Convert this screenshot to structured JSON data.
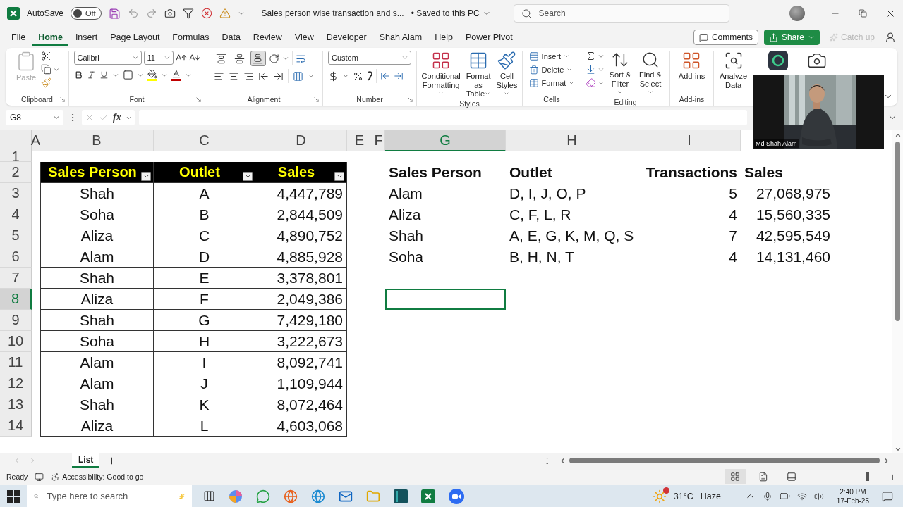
{
  "title_bar": {
    "autosave": {
      "label": "AutoSave",
      "state_label": "Off",
      "on": false
    },
    "document_title": "Sales person wise transaction and s...",
    "save_status": "• Saved to this PC",
    "search": {
      "placeholder": "Search"
    }
  },
  "menu_tabs": [
    {
      "label": "File",
      "selected": false
    },
    {
      "label": "Home",
      "selected": true
    },
    {
      "label": "Insert",
      "selected": false
    },
    {
      "label": "Page Layout",
      "selected": false
    },
    {
      "label": "Formulas",
      "selected": false
    },
    {
      "label": "Data",
      "selected": false
    },
    {
      "label": "Review",
      "selected": false
    },
    {
      "label": "View",
      "selected": false
    },
    {
      "label": "Developer",
      "selected": false
    },
    {
      "label": "Shah Alam",
      "selected": false
    },
    {
      "label": "Help",
      "selected": false
    },
    {
      "label": "Power Pivot",
      "selected": false
    }
  ],
  "header_actions": {
    "comments": "Comments",
    "share": "Share",
    "catch_up": {
      "label": "Catch up",
      "disabled": true
    }
  },
  "ribbon": {
    "groups": [
      {
        "kind": "clipboard",
        "label": "Clipboard",
        "paste": {
          "label": "Paste",
          "disabled": true
        }
      },
      {
        "kind": "font",
        "label": "Font",
        "font_name": "Calibri",
        "font_size": "11"
      },
      {
        "kind": "alignment",
        "label": "Alignment",
        "vertical_align": [
          {
            "selected": false
          },
          {
            "selected": false
          },
          {
            "selected": true
          }
        ]
      },
      {
        "kind": "number",
        "label": "Number",
        "format": "Custom"
      },
      {
        "kind": "styles",
        "label": "Styles",
        "buttons": [
          "Conditional\nFormatting",
          "Format as\nTable",
          "Cell\nStyles"
        ]
      },
      {
        "kind": "cells",
        "label": "Cells",
        "buttons": [
          "Insert",
          "Delete",
          "Format"
        ]
      },
      {
        "kind": "editing",
        "label": "Editing",
        "buttons": [
          "Sort &\nFilter",
          "Find &\nSelect"
        ]
      },
      {
        "kind": "addins",
        "label": "Add-ins",
        "buttons": [
          "Add-ins"
        ]
      },
      {
        "kind": "analysis",
        "buttons": [
          "Analyze\nData"
        ]
      }
    ]
  },
  "formula_bar": {
    "name_box": "G8",
    "function_label": "fx"
  },
  "sheet": {
    "columns": [
      {
        "label": "A",
        "selected": false
      },
      {
        "label": "B",
        "selected": false
      },
      {
        "label": "C",
        "selected": false
      },
      {
        "label": "D",
        "selected": false
      },
      {
        "label": "E",
        "selected": false
      },
      {
        "label": "F",
        "selected": false
      },
      {
        "label": "G",
        "selected": true
      },
      {
        "label": "H",
        "selected": false
      },
      {
        "label": "I",
        "selected": false
      }
    ],
    "rows": [
      {
        "label": "1",
        "selected": false
      },
      {
        "label": "2",
        "selected": false
      },
      {
        "label": "3",
        "selected": false
      },
      {
        "label": "4",
        "selected": false
      },
      {
        "label": "5",
        "selected": false
      },
      {
        "label": "6",
        "selected": false
      },
      {
        "label": "7",
        "selected": false
      },
      {
        "label": "8",
        "selected": true
      },
      {
        "label": "9",
        "selected": false
      },
      {
        "label": "10",
        "selected": false
      },
      {
        "label": "11",
        "selected": false
      },
      {
        "label": "12",
        "selected": false
      },
      {
        "label": "13",
        "selected": false
      },
      {
        "label": "14",
        "selected": false
      }
    ],
    "table_1": {
      "columns": [
        "Sales Person",
        "Outlet",
        "Sales"
      ],
      "rows": [
        [
          "Shah",
          "A",
          "4,447,789"
        ],
        [
          "Soha",
          "B",
          "2,844,509"
        ],
        [
          "Aliza",
          "C",
          "4,890,752"
        ],
        [
          "Alam",
          "D",
          "4,885,928"
        ],
        [
          "Shah",
          "E",
          "3,378,801"
        ],
        [
          "Aliza",
          "F",
          "2,049,386"
        ],
        [
          "Shah",
          "G",
          "7,429,180"
        ],
        [
          "Soha",
          "H",
          "3,222,673"
        ],
        [
          "Alam",
          "I",
          "8,092,741"
        ],
        [
          "Alam",
          "J",
          "1,109,944"
        ],
        [
          "Shah",
          "K",
          "8,072,464"
        ],
        [
          "Aliza",
          "L",
          "4,603,068"
        ]
      ]
    },
    "table_2": {
      "columns": [
        "Sales Person",
        "Outlet",
        "Transactions",
        "Sales"
      ],
      "rows": [
        [
          "Alam",
          "D, I, J, O, P",
          "5",
          "27,068,975"
        ],
        [
          "Aliza",
          "C, F, L, R",
          "4",
          "15,560,335"
        ],
        [
          "Shah",
          "A, E, G, K, M, Q, S",
          "7",
          "42,595,549"
        ],
        [
          "Soha",
          "B, H, N, T",
          "4",
          "14,131,460"
        ]
      ]
    }
  },
  "sheet_tabs": [
    {
      "label": "List",
      "selected": true
    }
  ],
  "status_bar": {
    "status": "Ready",
    "accessibility": "Accessibility: Good to go",
    "zoom_slider": {
      "level": 0.75
    }
  },
  "video_overlay": {
    "kind": "picture",
    "name": "Md Shah Alam"
  },
  "taskbar": {
    "search": {
      "placeholder": "Type here to search"
    },
    "weather": {
      "temperature": "31°C",
      "condition": "Haze"
    },
    "clock": {
      "time": "2:40 PM",
      "date": "17-Feb-25"
    }
  }
}
